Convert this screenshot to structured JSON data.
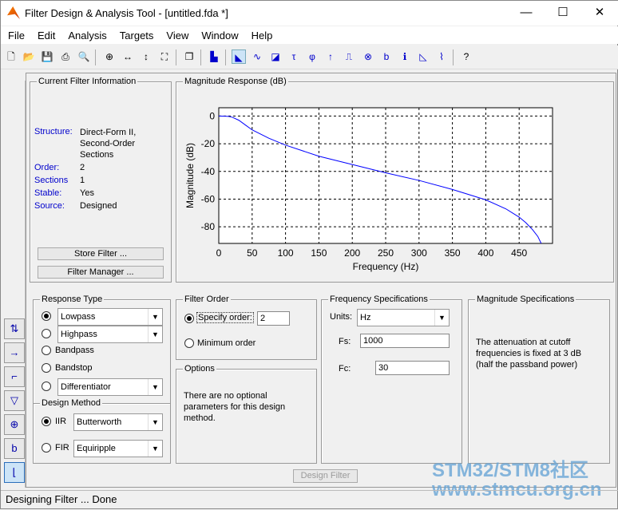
{
  "window": {
    "title": "Filter Design & Analysis Tool -  [untitled.fda *]",
    "minimize": "—",
    "maximize": "☐",
    "close": "✕"
  },
  "menu": [
    "File",
    "Edit",
    "Analysis",
    "Targets",
    "View",
    "Window",
    "Help"
  ],
  "toolbar": [
    "new-icon",
    "open-icon",
    "save-icon",
    "print-icon",
    "print-preview-icon",
    "zoom-in-icon",
    "zoom-x-icon",
    "zoom-y-icon",
    "full-view-icon",
    "new-window-icon",
    "filter-specs-icon",
    "magnitude-response-icon",
    "phase-response-icon",
    "magnitude-phase-icon",
    "group-delay-icon",
    "phase-delay-icon",
    "impulse-response-icon",
    "step-response-icon",
    "pole-zero-icon",
    "coefficients-icon",
    "filter-info-icon",
    "magnitude-estimate-icon",
    "noise-power-icon",
    "whats-this-icon"
  ],
  "current_filter": {
    "title": "Current Filter Information",
    "structure_label": "Structure:",
    "structure_value": "Direct-Form II, Second-Order Sections",
    "order_label": "Order:",
    "order_value": "2",
    "sections_label": "Sections",
    "sections_value": "1",
    "stable_label": "Stable:",
    "stable_value": "Yes",
    "source_label": "Source:",
    "source_value": "Designed",
    "store_button": "Store Filter ...",
    "manager_button": "Filter Manager ..."
  },
  "chart_data": {
    "type": "line",
    "title": "Magnitude Response (dB)",
    "xlabel": "Frequency (Hz)",
    "ylabel": "Magnitude (dB)",
    "xlim": [
      0,
      500
    ],
    "ylim": [
      -92,
      6
    ],
    "xticks": [
      0,
      50,
      100,
      150,
      200,
      250,
      300,
      350,
      400,
      450
    ],
    "yticks": [
      0,
      -20,
      -40,
      -60,
      -80
    ],
    "grid": true,
    "color": "#0000ff",
    "x": [
      0,
      10,
      15,
      20,
      30,
      40,
      50,
      75,
      100,
      150,
      200,
      250,
      300,
      350,
      400,
      430,
      450,
      460,
      470,
      478,
      483
    ],
    "y": [
      0,
      -0.1,
      -0.3,
      -0.8,
      -3,
      -6.5,
      -10,
      -16,
      -21,
      -29,
      -35,
      -41,
      -46.5,
      -53,
      -60.5,
      -67,
      -73,
      -77,
      -82,
      -87,
      -92
    ]
  },
  "response_type": {
    "title": "Response Type",
    "options": [
      {
        "label": "Lowpass",
        "selected": true,
        "dropdown": "Lowpass"
      },
      {
        "label": "Highpass",
        "dropdown": "Highpass"
      },
      {
        "label": "Bandpass"
      },
      {
        "label": "Bandstop"
      },
      {
        "label": "Differentiator",
        "dropdown": "Differentiator"
      }
    ]
  },
  "design_method": {
    "title": "Design Method",
    "iir_label": "IIR",
    "iir_value": "Butterworth",
    "fir_label": "FIR",
    "fir_value": "Equiripple",
    "selected": "IIR"
  },
  "filter_order": {
    "title": "Filter Order",
    "specify_label": "Specify order:",
    "specify_value": "2",
    "minimum_label": "Minimum order",
    "selected": "specify"
  },
  "options": {
    "title": "Options",
    "text": "There are no optional parameters for this design method."
  },
  "freq_specs": {
    "title": "Frequency Specifications",
    "units_label": "Units:",
    "units_value": "Hz",
    "fs_label": "Fs:",
    "fs_value": "1000",
    "fc_label": "Fc:",
    "fc_value": "30"
  },
  "mag_specs": {
    "title": "Magnitude Specifications",
    "text": "The attenuation at cutoff frequencies is fixed at 3 dB (half the passband power)"
  },
  "design_button": "Design Filter",
  "status": "Designing Filter ... Done",
  "watermark": "STM32/STM8社区 www.stmcu.org.cn",
  "side_buttons": [
    "transform-filter-icon",
    "realize-model-icon",
    "import-filter-icon",
    "quantize-icon",
    "pole-zero-editor-icon",
    "coefficients-export-icon",
    "design-filter-icon"
  ]
}
